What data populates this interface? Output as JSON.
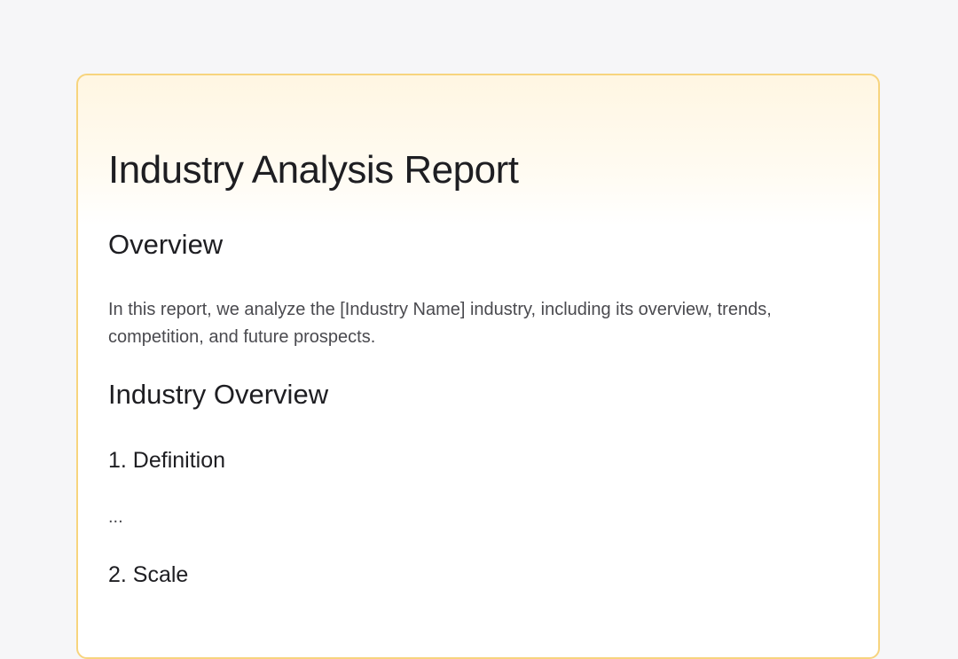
{
  "report": {
    "title": "Industry Analysis Report",
    "overview_heading": "Overview",
    "overview_text": "In this report, we analyze the [Industry Name] industry, including its overview, trends, competition, and future prospects.",
    "industry_overview_heading": "Industry Overview",
    "sections": [
      {
        "heading": "1. Definition",
        "body": "..."
      },
      {
        "heading": "2. Scale"
      }
    ]
  },
  "colors": {
    "page_background": "#f6f6f8",
    "card_border": "#f7d47e",
    "card_header_tint": "#fff6e2",
    "heading_text": "#1e1e22",
    "body_text": "#4a4a4f"
  }
}
